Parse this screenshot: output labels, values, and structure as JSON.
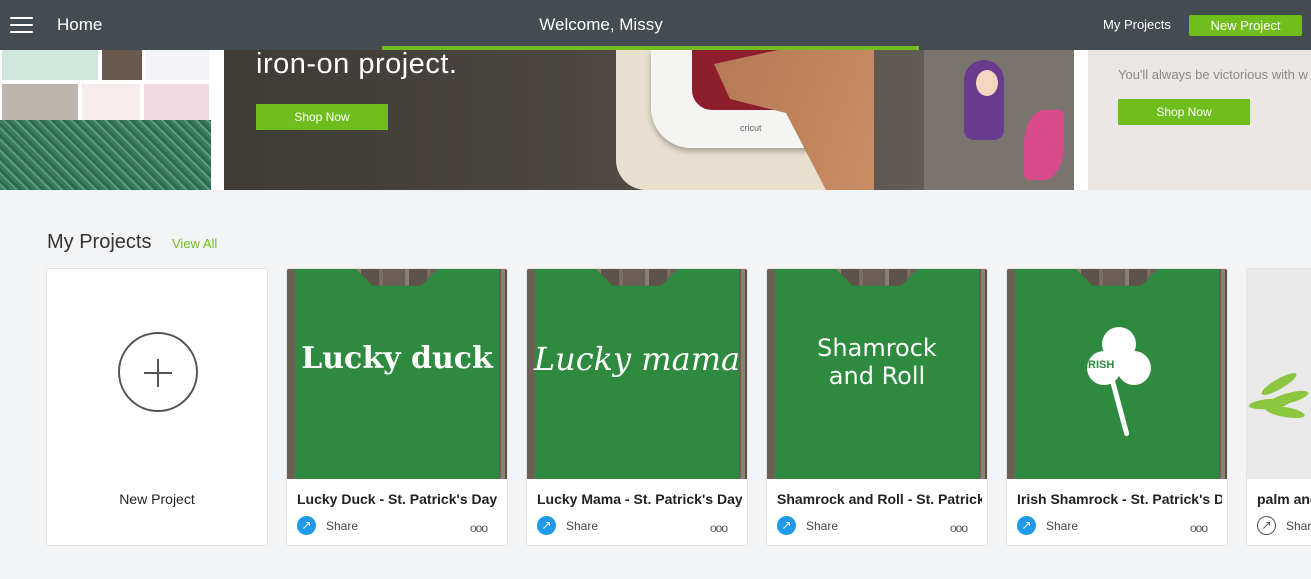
{
  "topbar": {
    "home_label": "Home",
    "welcome": "Welcome, Missy",
    "my_projects_link": "My Projects",
    "new_project_button": "New Project"
  },
  "banner": {
    "headline": "iron-on project.",
    "shop_now_1": "Shop Now",
    "right_tagline": "You'll always be victorious with w",
    "shop_now_2": "Shop Now",
    "press_logo": "cricut"
  },
  "projects": {
    "section_title": "My Projects",
    "view_all": "View All",
    "new_project_label": "New Project",
    "share_label": "Share",
    "more_glyph": "ooo",
    "items": [
      {
        "title": "Lucky Duck - St. Patrick's Day",
        "print": "Lucky duck"
      },
      {
        "title": "Lucky Mama - St. Patrick's Day",
        "print": "Lucky mama"
      },
      {
        "title": "Shamrock and Roll - St. Patrick's Day",
        "print_line1": "Shamrock",
        "print_line2": "and Roll"
      },
      {
        "title": "Irish Shamrock - St. Patrick's Day",
        "print": "IRISH"
      },
      {
        "title": "palm and",
        "print": ""
      }
    ]
  },
  "colors": {
    "topbar_bg": "#444c52",
    "accent_green": "#6fbe1e",
    "share_blue": "#1e9be8",
    "shirt_green": "#2d8a3e"
  }
}
